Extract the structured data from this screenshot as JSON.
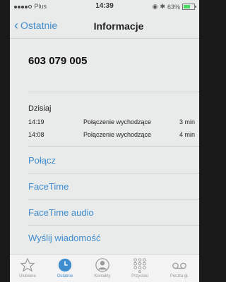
{
  "status": {
    "carrier": "Plus",
    "time": "14:39",
    "battery": "63%",
    "battery_level": 0.63
  },
  "nav": {
    "back_label": "Ostatnie",
    "title": "Informacje"
  },
  "contact": {
    "number": "603 079 005"
  },
  "history": {
    "day": "Dzisiaj",
    "calls": [
      {
        "time": "14:19",
        "type": "Połączenie wychodzące",
        "duration": "3 min"
      },
      {
        "time": "14:08",
        "type": "Połączenie wychodzące",
        "duration": "4 min"
      }
    ]
  },
  "actions": [
    "Połącz",
    "FaceTime",
    "FaceTime audio",
    "Wyślij wiadomość"
  ],
  "tabs": [
    {
      "label": "Ulubione",
      "icon": "star-icon"
    },
    {
      "label": "Ostatnie",
      "icon": "clock-icon"
    },
    {
      "label": "Kontakty",
      "icon": "contacts-icon"
    },
    {
      "label": "Przyciski",
      "icon": "keypad-icon"
    },
    {
      "label": "Poczta gł.",
      "icon": "voicemail-icon"
    }
  ],
  "colors": {
    "accent": "#3f8ccf",
    "background": "#e9ebea"
  }
}
